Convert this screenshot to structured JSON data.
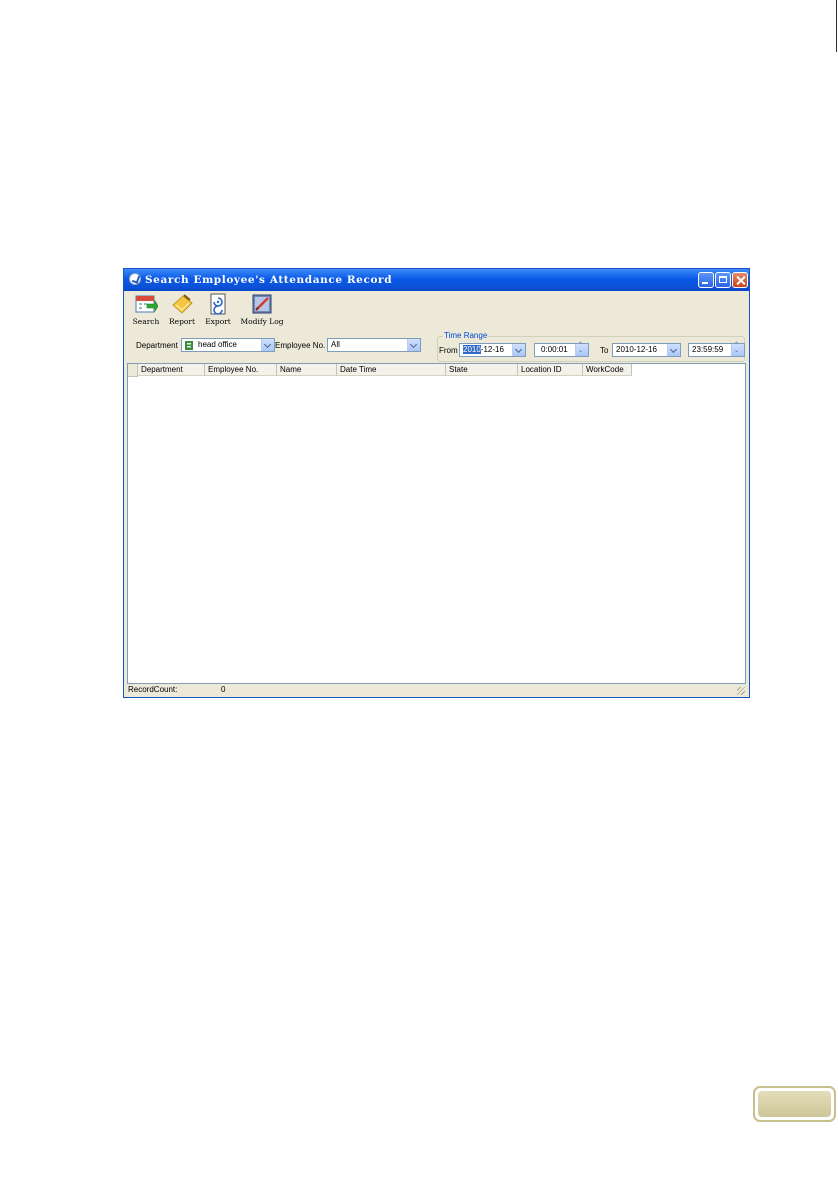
{
  "window": {
    "title": "Search Employee's Attendance Record"
  },
  "toolbar": {
    "buttons": [
      {
        "label": "Search",
        "icon": "search-calendar-icon"
      },
      {
        "label": "Report",
        "icon": "report-icon"
      },
      {
        "label": "Export",
        "icon": "export-icon"
      },
      {
        "label": "Modify Log",
        "icon": "modify-log-icon"
      }
    ]
  },
  "filters": {
    "department_label": "Department",
    "department_value": "head office",
    "employee_label": "Employee No.",
    "employee_value": "All",
    "time_range_label": "Time Range",
    "from_label": "From",
    "from_date_highlight": "2010",
    "from_date_rest": "-12-16",
    "from_time": "0:00:01",
    "to_label": "To",
    "to_date": "2010-12-16",
    "to_time": "23:59:59"
  },
  "grid": {
    "columns": [
      "Department",
      "Employee No.",
      "Name",
      "Date Time",
      "State",
      "Location ID",
      "WorkCode"
    ],
    "rows": []
  },
  "status": {
    "record_count_label": "RecordCount:",
    "record_count_value": "0"
  },
  "colors": {
    "titlebar": "#0a59e8",
    "window_bg": "#ece9d8",
    "accent": "#316ac5"
  }
}
